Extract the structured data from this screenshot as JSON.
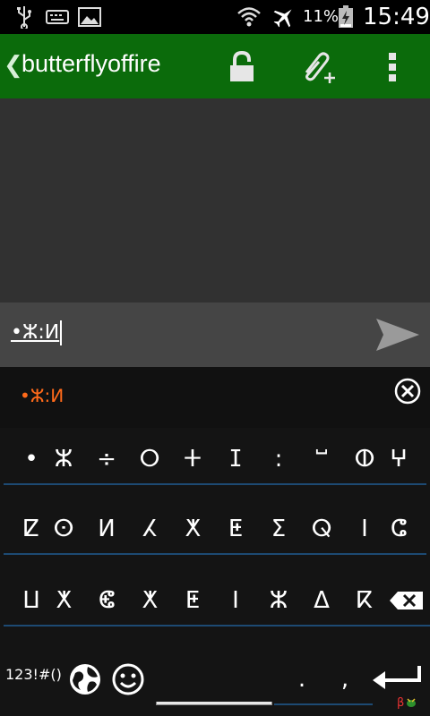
{
  "status_bar": {
    "icons": [
      "usb-icon",
      "keyboard-icon",
      "image-icon",
      "wifi-icon",
      "airplane-icon",
      "battery-icon"
    ],
    "battery_percent": "11%",
    "time": "15:49"
  },
  "action_bar": {
    "title": "butterflyoffire",
    "back_glyph": "❮",
    "lock_icon": "lock-icon",
    "attach_icon": "attach-add-icon",
    "overflow_icon": "overflow-menu-icon",
    "color": "#0b6b0b"
  },
  "compose": {
    "value": "•ⵣ:ⵍ",
    "send_icon": "send-icon"
  },
  "keyboard": {
    "suggestion": "•ⵣ:ⵍ",
    "suggestion_color": "#ff6a1a",
    "row1": [
      "•",
      "ⵣ",
      "÷",
      "ⵔ",
      "ⵜ",
      "ⵊ",
      ":",
      "ⵯ",
      "ⵀ",
      "ⵖ"
    ],
    "row2": [
      "ⵇ",
      "ⵙ",
      "ⵍ",
      "ⵃ",
      "ⵅ",
      "ⵟ",
      "ⵉ",
      "ⵕ",
      "ⵏ",
      "ⵛ"
    ],
    "row3": [
      "ⵡ",
      "ⵅ",
      "ⵞ",
      "ⵅ",
      "ⵟ",
      "ⵏ",
      "ⵣ",
      "ⵠ",
      "ⴽ"
    ],
    "num_key": "123!#()",
    "period": ".",
    "comma": ",",
    "brand_mark": "β"
  }
}
